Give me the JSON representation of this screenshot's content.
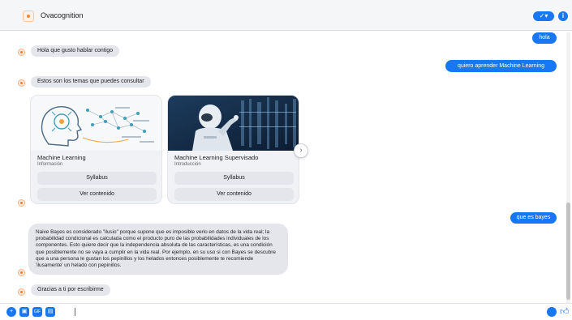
{
  "header": {
    "page_name": "Ovacognition",
    "badge_icon": "checkmark-icon",
    "info_icon": "info-icon"
  },
  "messages": {
    "out_hola": "hola",
    "in_greeting": "Hola que gusto hablar contigo",
    "out_aprender": "quiero aprender Machine Learning",
    "in_temas": "Estos son los temas que puedes consultar",
    "out_bayes": "que es bayes",
    "in_bayes_answer": "Naive Bayes es considerado \"ilusio\" porque supone que es imposible verlo en datos de la vida real; la probabilidad condicional es calculada como el producto puro de las probabilidades individuales de los componentes. Esto quiere decir que la independencia absoluta de las características, es una condición que posiblemente no se vaya a cumplir en la vida real. Por ejemplo, en su uso si con Bayes se descubre que a una persona le gustan los pepinillos y los helados entonces posiblemente te recomiende 'ilusamente' un helado con pepinillos.",
    "in_thanks": "Gracias a ti por escribirme"
  },
  "carousel": {
    "cards": [
      {
        "title": "Machine Learning",
        "subtitle": "Información",
        "buttons": [
          "Syllabus",
          "Ver contenido"
        ]
      },
      {
        "title": "Machine Learning Supervisado",
        "subtitle": "Introducción",
        "buttons": [
          "Syllabus",
          "Ver contenido"
        ]
      }
    ],
    "next_glyph": "›"
  },
  "composer": {
    "placeholder": "",
    "tools": [
      "plus-icon",
      "sticker-icon",
      "gif-icon",
      "image-icon"
    ],
    "right_icons": [
      "emoji-icon",
      "like-icon"
    ]
  },
  "colors": {
    "accent": "#1877f2",
    "bubble_in": "#e4e6eb",
    "brand_orange": "#ef7f2e"
  }
}
